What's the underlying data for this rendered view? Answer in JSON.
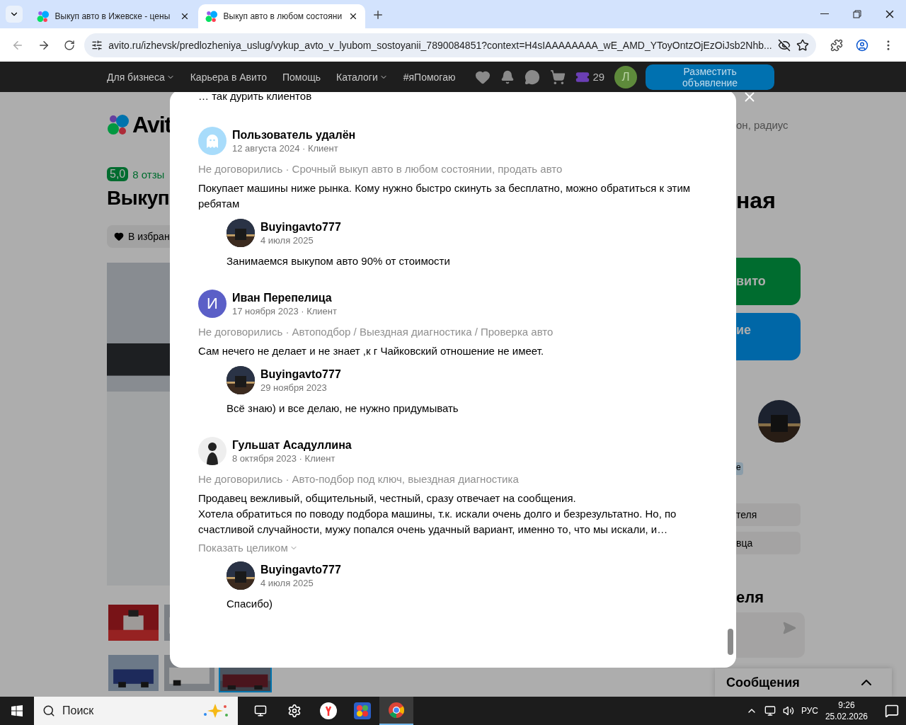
{
  "browser": {
    "tabs": [
      {
        "title": "Выкуп авто в Ижевске - цены",
        "selected": false
      },
      {
        "title": "Выкуп авто в любом состояни",
        "selected": true
      }
    ],
    "url": "avito.ru/izhevsk/predlozheniya_uslug/vykup_avto_v_lyubom_sostoyanii_7890084851?context=H4sIAAAAAAAA_wE_AMD_YToyOntzOjEzOiJsb2Nhb..."
  },
  "site_nav": {
    "items": [
      {
        "label": "Для бизнеса",
        "dropdown": true
      },
      {
        "label": "Карьера в Авито",
        "dropdown": false
      },
      {
        "label": "Помощь",
        "dropdown": false
      },
      {
        "label": "Каталоги",
        "dropdown": true
      },
      {
        "label": "#яПомогаю",
        "dropdown": false
      }
    ],
    "bonus_count": "29",
    "avatar_letter": "Л",
    "post_button": "Разместить объявление"
  },
  "page_behind": {
    "logo_text": "Avit",
    "rating": "5,0",
    "reviews_link": "8 отзы",
    "title_left": "Выкуп",
    "favorite_button": "В избран",
    "location_text": "он, радиус",
    "title_right": "ная",
    "green_button": "вито",
    "blue_button": "ие",
    "badge": "е",
    "info_rows": [
      "теля",
      "вца"
    ],
    "section_title": "еля",
    "messages_panel": "Сообщения",
    "thumbnails": [
      [
        {
          "selected": false
        },
        {
          "selected": false
        }
      ],
      [
        {
          "selected": false
        },
        {
          "selected": false
        },
        {
          "selected": true
        }
      ]
    ]
  },
  "modal": {
    "top_text": "… так дурить клиентов",
    "reviews": [
      {
        "author": "Пользователь удалён",
        "avatar": {
          "kind": "ghost"
        },
        "meta": "12 августа 2024 · Клиент",
        "deal": "Не договорились · Срочный выкуп авто в любом состоянии, продать авто",
        "paragraphs": [
          "Покупает машины ниже рынка. Кому нужно быстро скинуть за бесплатно, можно обратиться к этим ребятам"
        ],
        "reply": {
          "author": "Buyingavto777",
          "date": "4 июля 2025",
          "text": "Занимаемся выкупом авто 90% от стоимости"
        }
      },
      {
        "author": "Иван Перепелица",
        "avatar": {
          "kind": "letter",
          "letter": "И"
        },
        "meta": "17 ноября 2023 · Клиент",
        "deal": "Не договорились · Автоподбор / Выездная диагностика / Проверка авто",
        "paragraphs": [
          "Сам нечего не делает и не знает ,к г Чайковский отношение не имеет."
        ],
        "reply": {
          "author": "Buyingavto777",
          "date": "29 ноября 2023",
          "text": "Всё знаю) и все делаю, не нужно придумывать"
        }
      },
      {
        "author": "Гульшат Асадуллина",
        "avatar": {
          "kind": "person"
        },
        "meta": "8 октября 2023 · Клиент",
        "deal": "Не договорились · Авто-подбор под ключ, выездная диагностика",
        "paragraphs": [
          "Продавец вежливый, общительный, честный, сразу отвечает на сообщения.",
          "Хотела обратиться по поводу подбора машины, т.к. искали очень долго и безрезультатно. Но, по счастливой случайности, мужу попался очень удачный вариант, именно то, что мы искали, и…"
        ],
        "show_more": "Показать целиком",
        "reply": {
          "author": "Buyingavto777",
          "date": "4 июля 2025",
          "text": "Спасибо)"
        }
      }
    ]
  },
  "taskbar": {
    "search_placeholder": "Поиск",
    "language": "РУС",
    "time": "9:26",
    "date": "25.02.2026"
  }
}
